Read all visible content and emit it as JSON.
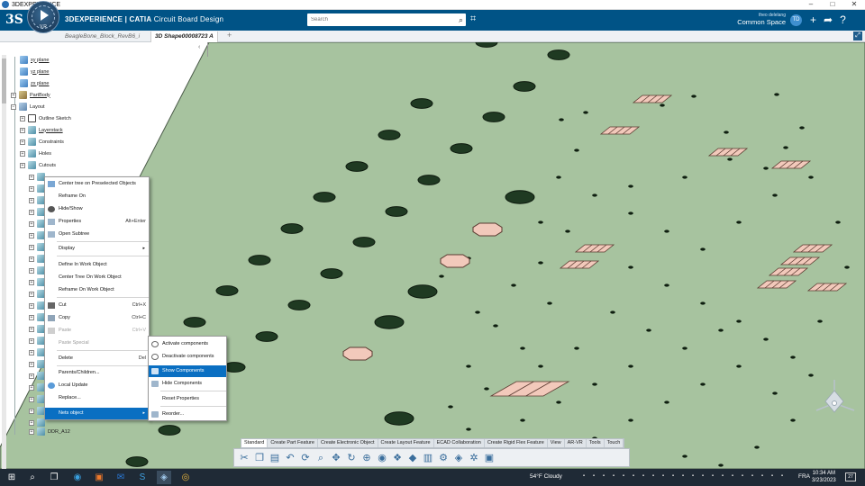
{
  "window": {
    "title": "3DEXPERIENCE",
    "controls": [
      "–",
      "□",
      "✕"
    ]
  },
  "header": {
    "logo": "3S",
    "compass_version": "V,R",
    "brand_prefix": "3DEXPERIENCE | CATIA",
    "brand_app": "Circuit Board Design",
    "search_placeholder": "Search",
    "user_name": "theo delelang",
    "space": "Common Space",
    "avatar_initials": "TD",
    "accent_color": "#005386"
  },
  "tabs": [
    {
      "label": "BeagleBone_Block_RevB6_i"
    },
    {
      "label": "3D Shape00008723 A"
    }
  ],
  "tree": {
    "nodes": [
      {
        "label": "xy plane"
      },
      {
        "label": "yz plane"
      },
      {
        "label": "zx plane"
      },
      {
        "label": "PartBody"
      },
      {
        "label": "Layout"
      },
      {
        "label": "Outline Sketch"
      },
      {
        "label": "Layerstack"
      },
      {
        "label": "Constraints"
      },
      {
        "label": "Holes"
      },
      {
        "label": "Cutouts"
      },
      {
        "label": "DDR_A12"
      }
    ]
  },
  "context_menu": {
    "items": [
      {
        "label": "Center tree on Preselected Objects",
        "shortcut": ""
      },
      {
        "label": "Reframe On",
        "shortcut": ""
      },
      {
        "label": "Hide/Show",
        "shortcut": ""
      },
      {
        "label": "Properties",
        "shortcut": "Alt+Enter"
      },
      {
        "label": "Open Subtree",
        "shortcut": ""
      },
      {
        "label": "Display",
        "shortcut": ""
      },
      {
        "label": "Define In Work Object",
        "shortcut": ""
      },
      {
        "label": "Center Tree On Work Object",
        "shortcut": ""
      },
      {
        "label": "Reframe On Work Object",
        "shortcut": ""
      },
      {
        "label": "Cut",
        "shortcut": "Ctrl+X"
      },
      {
        "label": "Copy",
        "shortcut": "Ctrl+C"
      },
      {
        "label": "Paste",
        "shortcut": "Ctrl+V"
      },
      {
        "label": "Paste Special",
        "shortcut": ""
      },
      {
        "label": "Delete",
        "shortcut": "Del"
      },
      {
        "label": "Parents/Children...",
        "shortcut": ""
      },
      {
        "label": "Local Update",
        "shortcut": ""
      },
      {
        "label": "Replace...",
        "shortcut": ""
      },
      {
        "label": "Nets object",
        "shortcut": ""
      }
    ]
  },
  "submenu": {
    "items": [
      {
        "label": "Activate components"
      },
      {
        "label": "Deactivate components"
      },
      {
        "label": "Show Components"
      },
      {
        "label": "Hide Components"
      },
      {
        "label": "Reset Properties"
      },
      {
        "label": "Reorder..."
      }
    ]
  },
  "action_bar": {
    "tabs": [
      {
        "label": "Standard"
      },
      {
        "label": "Create Part Feature"
      },
      {
        "label": "Create Electronic Object"
      },
      {
        "label": "Create Layout Feature"
      },
      {
        "label": "ECAD Collaboration"
      },
      {
        "label": "Create Rigid Flex Feature"
      },
      {
        "label": "View"
      },
      {
        "label": "AR-VR"
      },
      {
        "label": "Tools"
      },
      {
        "label": "Touch"
      }
    ]
  },
  "board": {
    "board_color": "#a7c39f",
    "pad_color": "#f2c9bb",
    "hole_color": "#1f3a22"
  },
  "taskbar": {
    "weather": "54°F  Cloudy",
    "language": "FRA",
    "time": "10:34 AM",
    "date": "3/23/2023",
    "notifications": "27"
  }
}
